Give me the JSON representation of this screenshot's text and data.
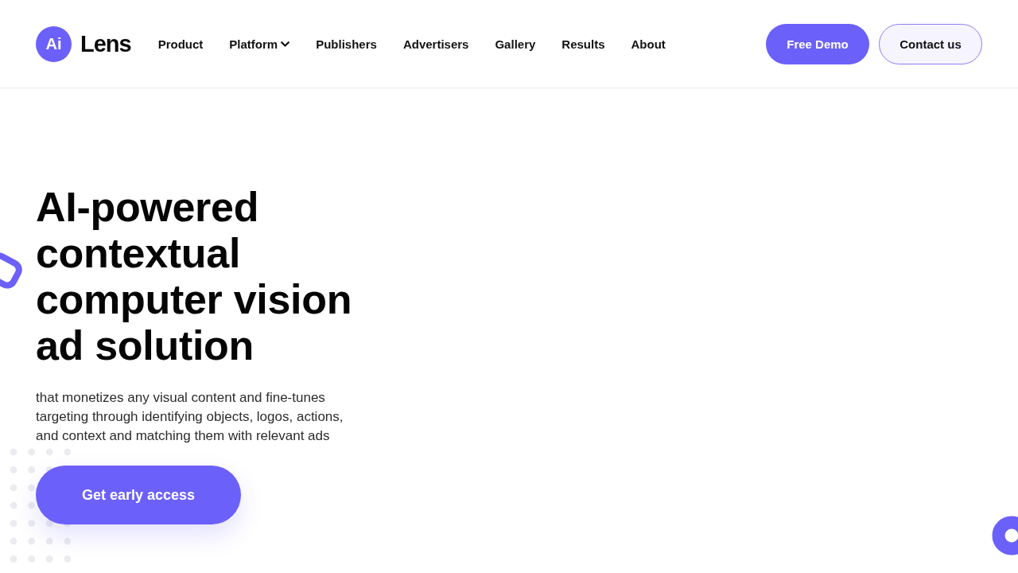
{
  "header": {
    "logo": {
      "badge": "Ai",
      "name": "Lens"
    },
    "nav": [
      {
        "label": "Product",
        "kind": "link"
      },
      {
        "label": "Platform",
        "kind": "dropdown"
      },
      {
        "label": "Publishers",
        "kind": "link"
      },
      {
        "label": "Advertisers",
        "kind": "link"
      },
      {
        "label": "Gallery",
        "kind": "link"
      },
      {
        "label": "Results",
        "kind": "link"
      },
      {
        "label": "About",
        "kind": "link"
      }
    ],
    "buttons": [
      {
        "label": "Free Demo",
        "kind": "primary"
      },
      {
        "label": "Contact us",
        "kind": "secondary"
      }
    ]
  },
  "hero": {
    "title": "AI-powered contextual computer vision ad solution",
    "description": "that monetizes any visual content and fine-tunes targeting through identifying objects, logos, actions, and context and matching them with relevant ads",
    "cta": "Get early access"
  }
}
